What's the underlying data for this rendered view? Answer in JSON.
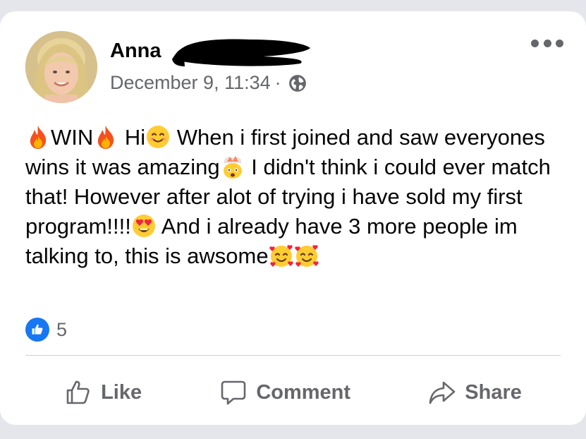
{
  "post": {
    "author_first_name": "Anna",
    "date": "December 9, 11:34",
    "separator": "·",
    "privacy_icon": "globe-icon",
    "menu_icon": "more-options-icon",
    "text": {
      "win_label": "WIN",
      "greeting": "Hi",
      "p1": " When i first joined and saw everyones wins it was amazing",
      "p2": " I didn't think i could ever match that! However after alot of trying i have sold my first program!!!!",
      "p3": " And i already have 3 more people im talking to, this is awsome"
    },
    "emojis": [
      "fire",
      "fire",
      "smiling-face",
      "exploding-head",
      "heart-eyes",
      "smiling-face-with-hearts",
      "smiling-face-with-hearts"
    ]
  },
  "reactions": {
    "icon": "thumbs-up-icon",
    "count": "5"
  },
  "actions": {
    "like": "Like",
    "comment": "Comment",
    "share": "Share"
  },
  "colors": {
    "text": "#050505",
    "secondary": "#65676b",
    "facebook_blue": "#1877f2",
    "card": "#ffffff",
    "background": "#e4e6eb"
  }
}
